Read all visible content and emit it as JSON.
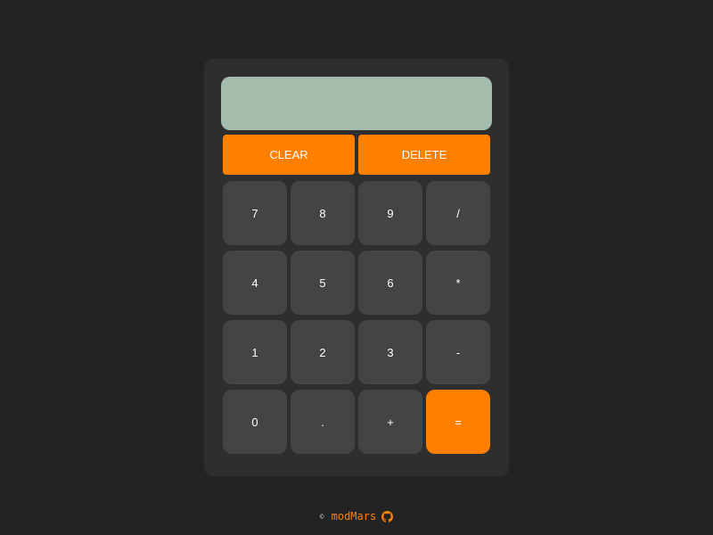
{
  "colors": {
    "background": "#232323",
    "calculator_body": "#2e2e2e",
    "display": "#a4bcab",
    "key": "#444444",
    "accent": "#ff8000"
  },
  "display": {
    "value": ""
  },
  "function_buttons": {
    "clear_label": "CLEAR",
    "delete_label": "DELETE"
  },
  "keys": [
    {
      "label": "7",
      "name": "key-7",
      "accent": false
    },
    {
      "label": "8",
      "name": "key-8",
      "accent": false
    },
    {
      "label": "9",
      "name": "key-9",
      "accent": false
    },
    {
      "label": "/",
      "name": "key-divide",
      "accent": false
    },
    {
      "label": "4",
      "name": "key-4",
      "accent": false
    },
    {
      "label": "5",
      "name": "key-5",
      "accent": false
    },
    {
      "label": "6",
      "name": "key-6",
      "accent": false
    },
    {
      "label": "*",
      "name": "key-multiply",
      "accent": false
    },
    {
      "label": "1",
      "name": "key-1",
      "accent": false
    },
    {
      "label": "2",
      "name": "key-2",
      "accent": false
    },
    {
      "label": "3",
      "name": "key-3",
      "accent": false
    },
    {
      "label": "-",
      "name": "key-subtract",
      "accent": false
    },
    {
      "label": "0",
      "name": "key-0",
      "accent": false
    },
    {
      "label": ".",
      "name": "key-decimal",
      "accent": false
    },
    {
      "label": "+",
      "name": "key-add",
      "accent": false
    },
    {
      "label": "=",
      "name": "key-equals",
      "accent": true
    }
  ],
  "footer": {
    "copyright_symbol": "©",
    "author": "modMars",
    "github_icon": "github-icon"
  }
}
